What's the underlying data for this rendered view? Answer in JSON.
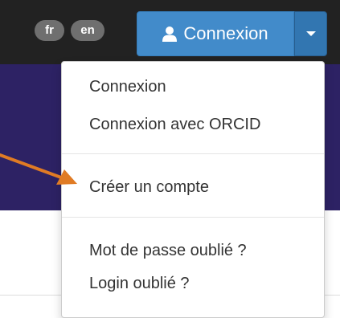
{
  "header": {
    "languages": [
      "fr",
      "en"
    ],
    "login_button_label": "Connexion"
  },
  "dropdown": {
    "items": [
      "Connexion",
      "Connexion avec ORCID",
      "Créer un compte",
      "Mot de passe oublié ?",
      "Login oublié ?"
    ]
  },
  "colors": {
    "topbar": "#222222",
    "banner": "#2d2264",
    "primary_button": "#428bca",
    "annotation_arrow": "#e07b24"
  },
  "icons": {
    "login": "user-icon",
    "toggle": "caret-down-icon",
    "annotation": "arrow-annotation-icon"
  }
}
